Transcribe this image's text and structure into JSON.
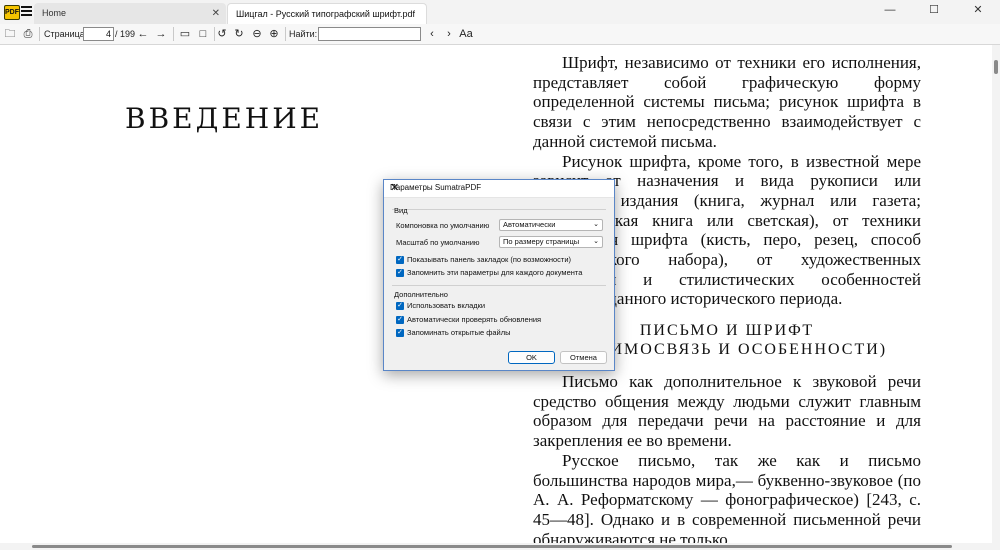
{
  "tabs": {
    "home": "Home",
    "active": "Шицгал - Русский типографский шрифт.pdf"
  },
  "window": {
    "minimize": "—",
    "maximize": "☐",
    "close": "✕",
    "tab_close": "✕"
  },
  "toolbar": {
    "page_label": "Страница:",
    "page_value": "4",
    "page_total": "/ 199",
    "find_label": "Найти:",
    "find_value": ""
  },
  "icons": {
    "open": "🗀",
    "print": "⎙",
    "prev": "←",
    "next": "→",
    "fit_width": "▭",
    "fit_page": "□",
    "rotate_left": "↺",
    "rotate_right": "↻",
    "zoom_out": "⊖",
    "zoom_in": "⊕",
    "find_prev": "‹",
    "find_next": "›",
    "match_case": "Aa"
  },
  "document": {
    "heading": "ВВЕДЕНИЕ",
    "para1": "Шрифт, независимо от техники его исполнения, представляет собой графическую форму определенной системы письма; рисунок шрифта в связи с этим непосредственно взаимодействует с данной системой письма.",
    "para2": "Рисунок шрифта, кроме того, в известной мере зависит от назначения и вида рукописи или печатного издания (книга, журнал или газета; литургическая книга или светская), от техники исполнения шрифта (кисть, перо, резец, способ типографского набора), от художественных требований и стилистических особенностей искусства данного исторического периода.",
    "subheading1": "ПИСЬМО И ШРИФТ",
    "subheading2": "(ВЗАИМОСВЯЗЬ И ОСОБЕННОСТИ)",
    "para3": "Письмо как дополнительное к звуковой речи средство общения между людьми служит главным образом для передачи речи на расстояние и для закрепления ее во времени.",
    "para4": "Русское письмо, так же как и письмо большинства народов мира,— буквенно-звуковое (по А. А. Реформатскому — фонографическое) [243, с. 45—48]. Однако и в современной письменной речи обнаруживаются не только"
  },
  "dialog": {
    "title": "Параметры SumatraPDF",
    "close": "✕",
    "view_group": "Вид",
    "layout_label": "Компоновка по умолчанию",
    "layout_value": "Автоматически",
    "zoom_label": "Масштаб по умолчанию",
    "zoom_value": "По размеру страницы",
    "chk_bookmarks": "Показывать панель закладок (по возможности)",
    "chk_remember": "Запомнить эти параметры для каждого документа",
    "advanced_group": "Дополнительно",
    "chk_tabs": "Использовать вкладки",
    "chk_updates": "Автоматически проверять обновления",
    "chk_files": "Запоминать открытые файлы",
    "ok": "OK",
    "cancel": "Отмена",
    "check_mark": "✓",
    "combo_arrow": "⌄"
  },
  "colors": {
    "accent": "#0067c0"
  }
}
